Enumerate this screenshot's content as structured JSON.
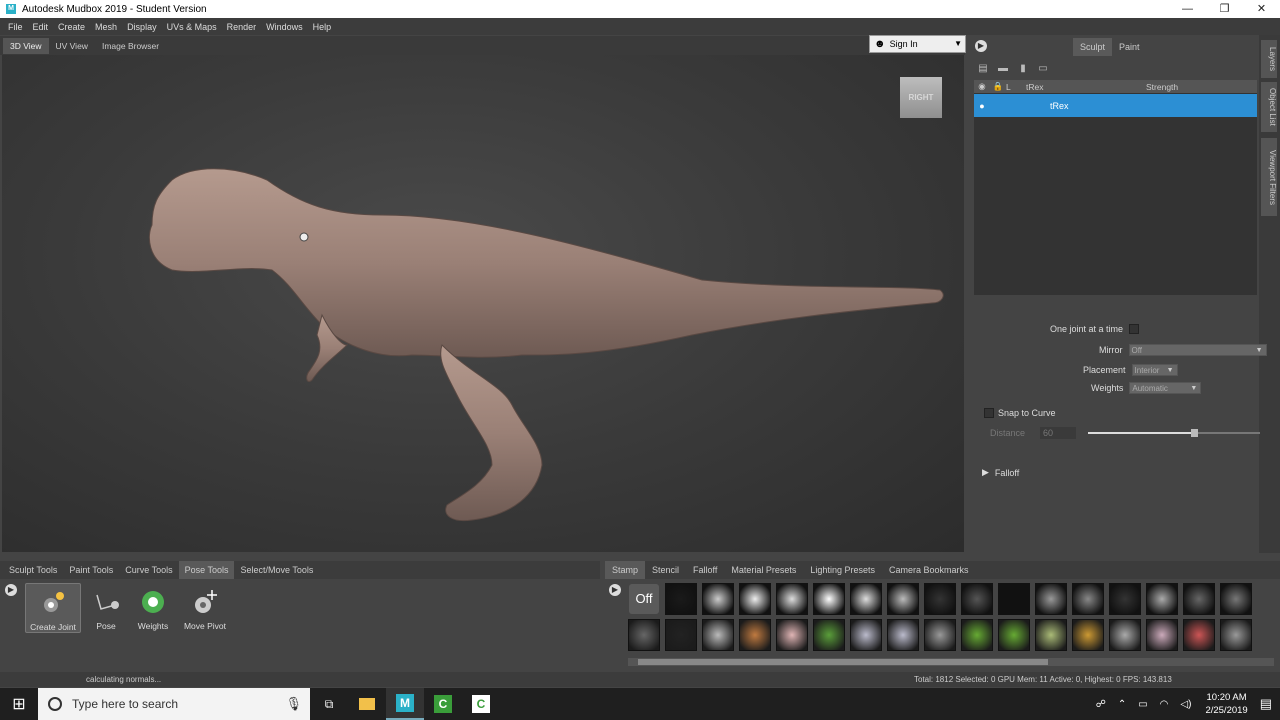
{
  "window": {
    "title": "Autodesk Mudbox 2019 - Student Version",
    "app_icon_label": "M"
  },
  "menu": [
    "File",
    "Edit",
    "Create",
    "Mesh",
    "Display",
    "UVs & Maps",
    "Render",
    "Windows",
    "Help"
  ],
  "view_tabs": [
    "3D View",
    "UV View",
    "Image Browser"
  ],
  "sign_in": "Sign In",
  "viewcube_label": "RIGHT",
  "panel_tabs": [
    "Sculpt",
    "Paint"
  ],
  "layers": {
    "header_name": "tRex",
    "header_lock": "L",
    "header_strength": "Strength",
    "row_name": "tRex"
  },
  "side_tabs": [
    "Layers",
    "Object List",
    "Viewport Filters"
  ],
  "props": {
    "one_joint_label": "One joint at a time",
    "mirror_label": "Mirror",
    "mirror_value": "Off",
    "placement_label": "Placement",
    "placement_value": "Interior",
    "weights_label": "Weights",
    "weights_value": "Automatic",
    "snap_label": "Snap to Curve",
    "distance_label": "Distance",
    "distance_value": "60",
    "distance_fraction": 0.6,
    "falloff_label": "Falloff"
  },
  "tool_tabs": [
    "Sculpt Tools",
    "Paint Tools",
    "Curve Tools",
    "Pose Tools",
    "Select/Move Tools"
  ],
  "tools": [
    "Create Joint",
    "Pose",
    "Weights",
    "Move Pivot"
  ],
  "stamp_tabs": [
    "Stamp",
    "Stencil",
    "Falloff",
    "Material Presets",
    "Lighting Presets",
    "Camera Bookmarks"
  ],
  "stamp_off": "Off",
  "status": {
    "left": "calculating normals...",
    "right": "Total: 1812  Selected: 0  GPU Mem: 11  Active: 0, Highest: 0  FPS: 143.813"
  },
  "taskbar": {
    "search_placeholder": "Type here to search",
    "time": "10:20 AM",
    "date": "2/25/2019"
  }
}
